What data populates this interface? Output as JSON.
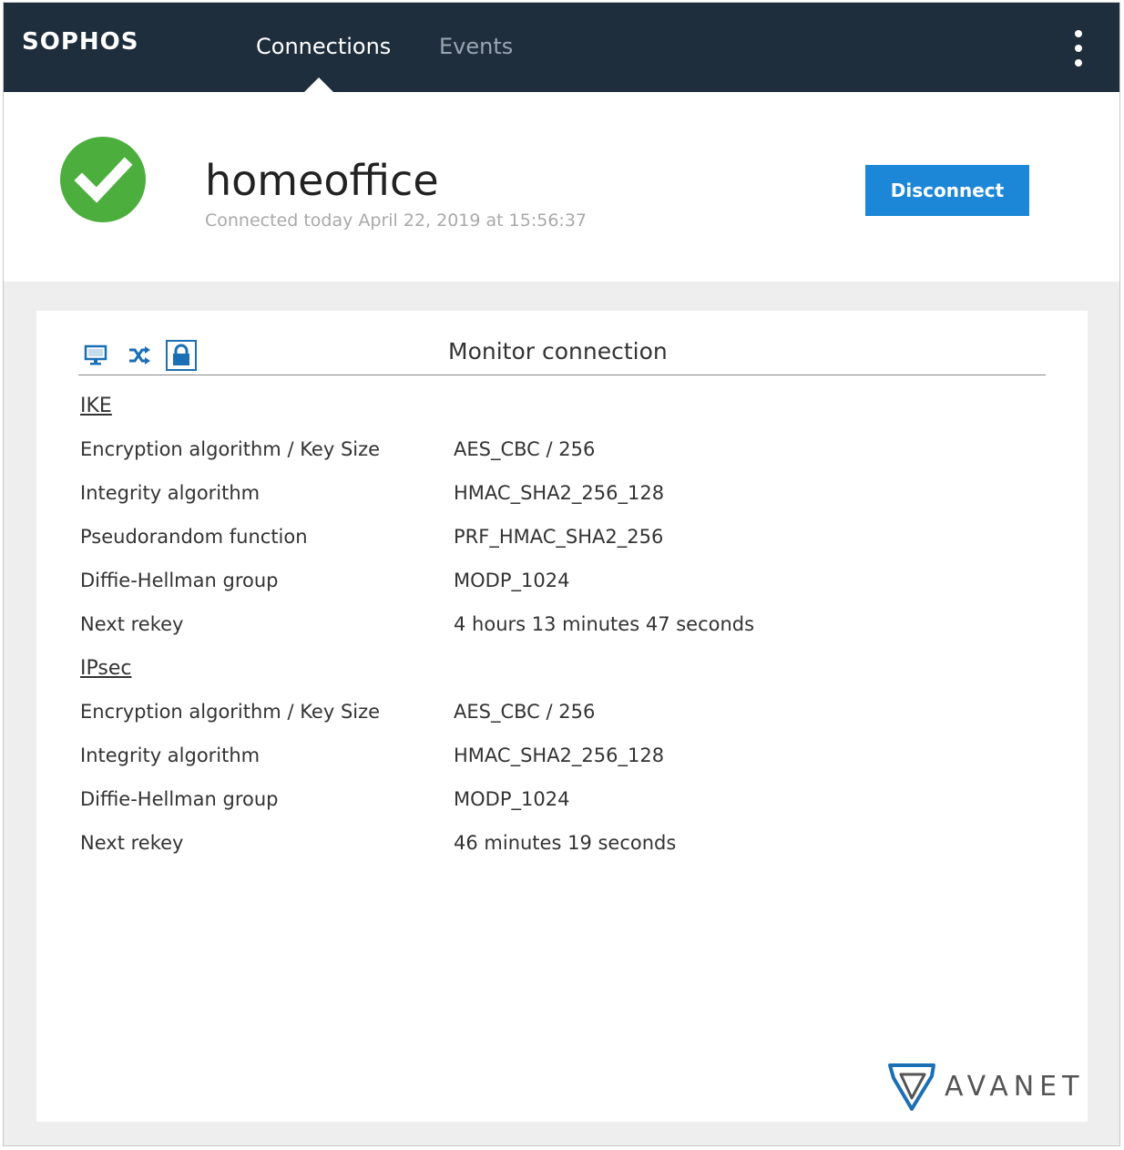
{
  "brand": "SOPHOS",
  "nav": {
    "tabs": [
      {
        "label": "Connections",
        "active": true
      },
      {
        "label": "Events",
        "active": false
      }
    ]
  },
  "connection": {
    "name": "homeoffice",
    "connected_text": "Connected today April 22, 2019 at 15:56:37",
    "status": "connected",
    "disconnect_label": "Disconnect"
  },
  "monitor": {
    "title": "Monitor connection",
    "icons": [
      "monitor-icon",
      "shuffle-icon",
      "lock-icon"
    ],
    "selected_icon": "lock-icon",
    "sections": [
      {
        "heading": "IKE",
        "rows": [
          {
            "label": "Encryption algorithm / Key Size",
            "value": "AES_CBC / 256"
          },
          {
            "label": "Integrity algorithm",
            "value": "HMAC_SHA2_256_128"
          },
          {
            "label": "Pseudorandom function",
            "value": "PRF_HMAC_SHA2_256"
          },
          {
            "label": "Diffie-Hellman group",
            "value": "MODP_1024"
          },
          {
            "label": "Next rekey",
            "value": "4 hours 13 minutes 47 seconds"
          }
        ]
      },
      {
        "heading": "IPsec",
        "rows": [
          {
            "label": "Encryption algorithm / Key Size",
            "value": "AES_CBC / 256"
          },
          {
            "label": "Integrity algorithm",
            "value": "HMAC_SHA2_256_128"
          },
          {
            "label": "Diffie-Hellman group",
            "value": "MODP_1024"
          },
          {
            "label": "Next rekey",
            "value": "46 minutes 19 seconds"
          }
        ]
      }
    ]
  },
  "watermark": "AVANET",
  "colors": {
    "topbar": "#1e2e3c",
    "accent": "#1b87d6",
    "success": "#4caf3d",
    "icon_blue": "#1b6fb5"
  }
}
